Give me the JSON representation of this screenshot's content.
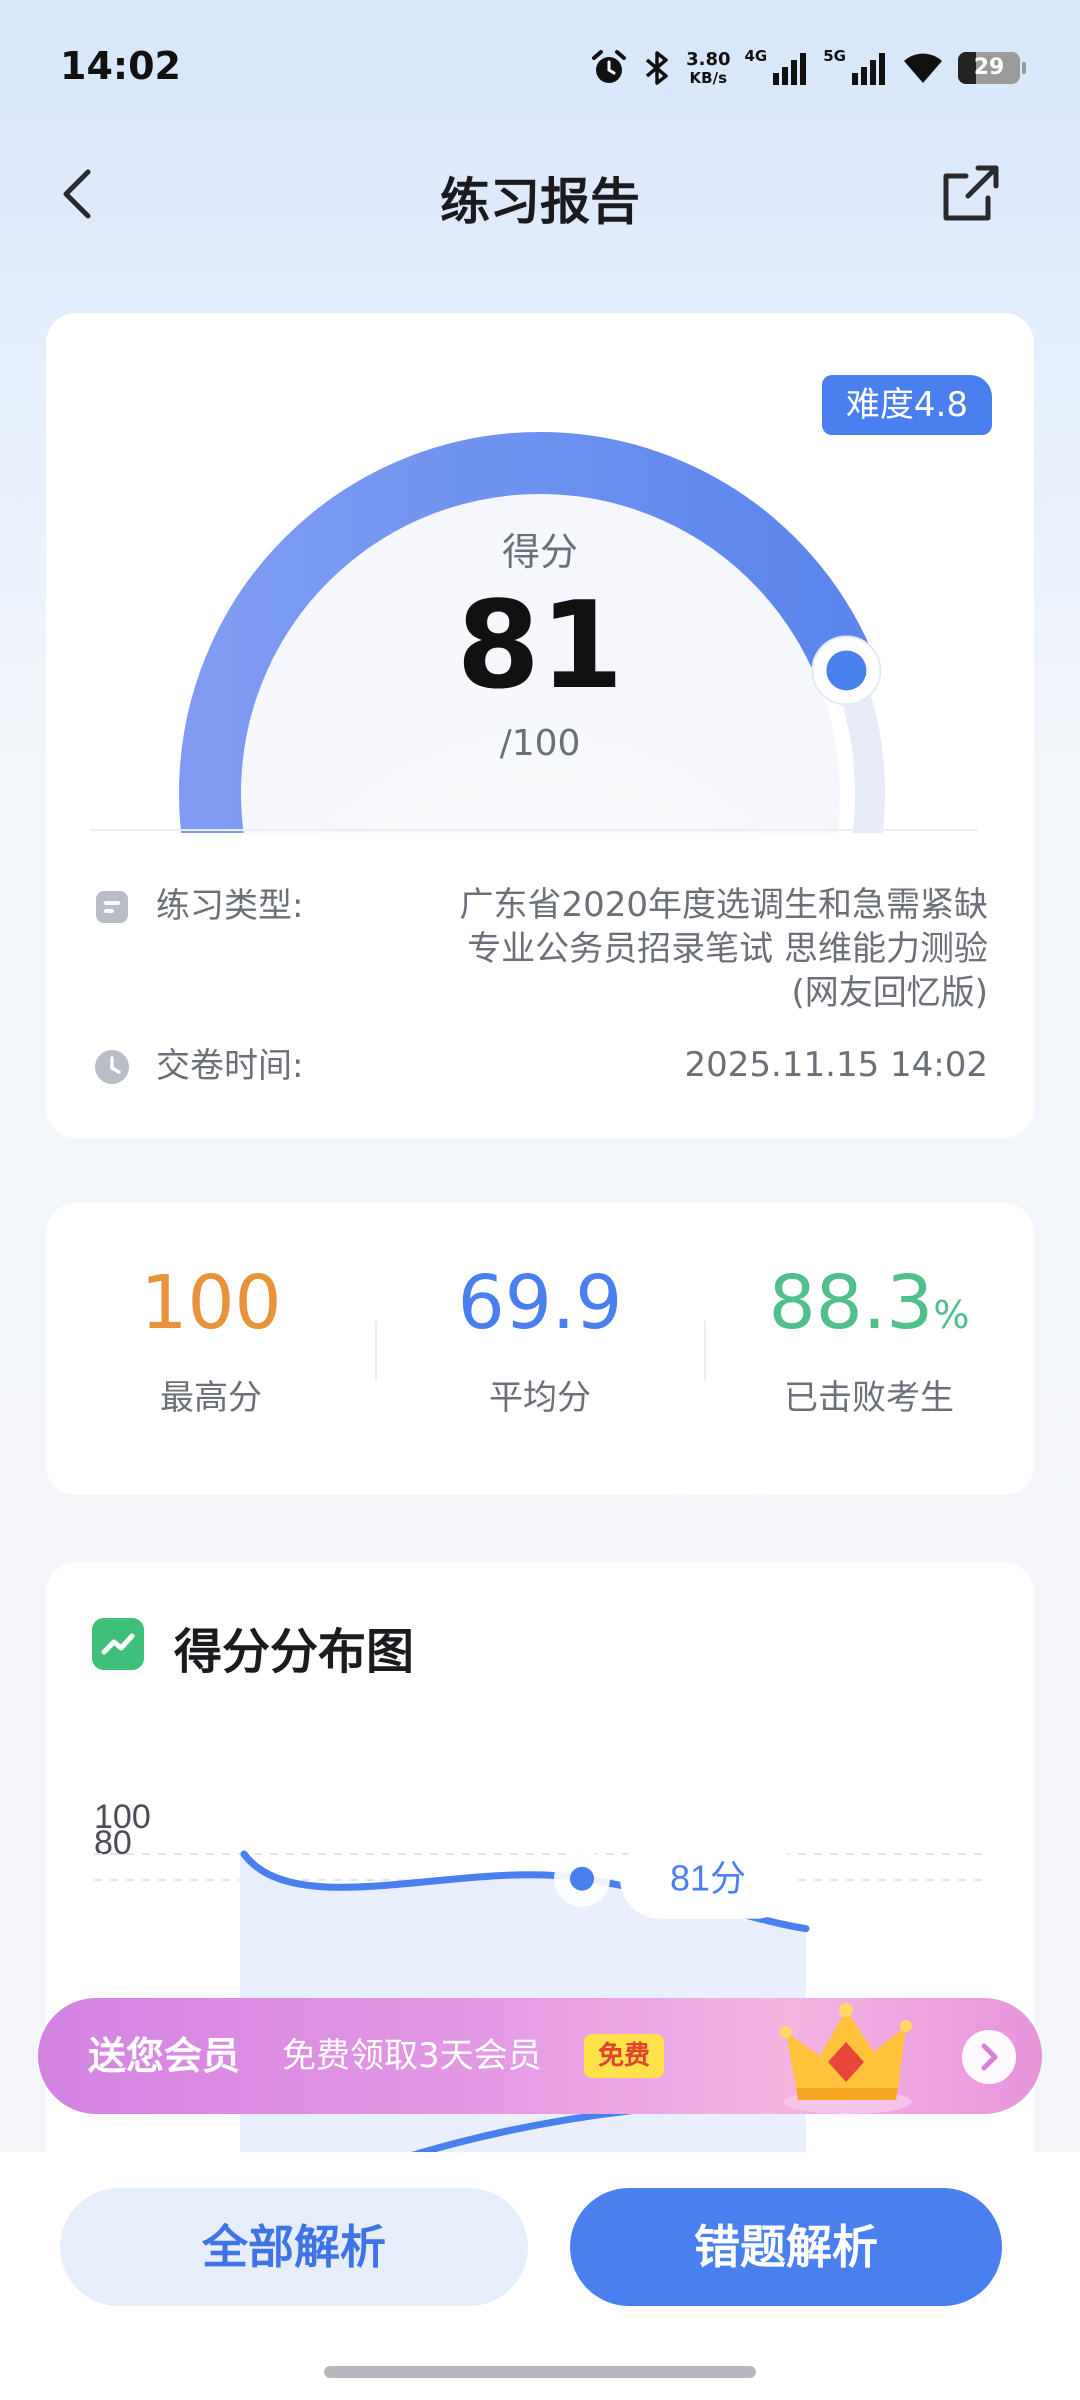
{
  "status_bar": {
    "time": "14:02",
    "net_speed_value": "3.80",
    "net_speed_unit": "KB/s",
    "sim1_label": "4G",
    "sim2_label": "5G",
    "battery": "29",
    "battery_level": 0.29,
    "icons": [
      "alarm-icon",
      "bluetooth-icon",
      "signal-icon",
      "signal-icon",
      "wifi-icon",
      "battery-icon"
    ]
  },
  "nav": {
    "title": "练习报告",
    "back_icon": "chevron-left-icon",
    "share_icon": "share-icon"
  },
  "score_card": {
    "difficulty": "难度4.8",
    "score_label": "得分",
    "score": "81",
    "score_total": "/100",
    "score_fraction": 0.81,
    "type_label": "练习类型:",
    "type_value_lines": [
      "广东省2020年度选调生和急需紧缺",
      "专业公务员招录笔试 思维能力测验",
      "(网友回忆版)"
    ],
    "time_label": "交卷时间:",
    "time_value": "2025.11.15 14:02"
  },
  "stats": {
    "max_value": "100",
    "max_label": "最高分",
    "avg_value": "69.9",
    "avg_label": "平均分",
    "beat_value": "88.3",
    "beat_unit": "%",
    "beat_label": "已击败考生"
  },
  "distribution": {
    "title": "得分分布图",
    "marker_label": "81分"
  },
  "chart_data": {
    "type": "line",
    "title": "得分分布图",
    "y_ticks": [
      "100",
      "80"
    ],
    "ylim": [
      0,
      100
    ],
    "grid": true,
    "annotation": {
      "label": "81分",
      "y": 81
    }
  },
  "promo": {
    "title": "送您会员",
    "subtitle": "免费领取3天会员",
    "badge": "免费"
  },
  "bottom": {
    "all_label": "全部解析",
    "wrong_label": "错题解析"
  },
  "colors": {
    "accent": "#4a7ff0",
    "max_orange": "#e8923a",
    "avg_blue": "#4a7ff0",
    "beat_green": "#4fbf8c"
  }
}
